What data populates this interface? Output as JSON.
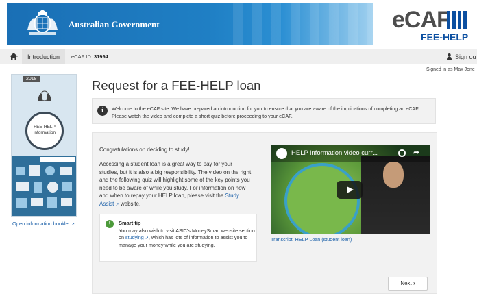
{
  "header": {
    "gov_title": "Australian Government",
    "logo_word": "eCAF",
    "logo_sub": "FEE-HELP"
  },
  "nav": {
    "intro_label": "Introduction",
    "ecaf_id_label": "eCAF ID:",
    "ecaf_id_value": "31994",
    "signout_label": "Sign ou",
    "signed_in": "Signed in as Max Jone"
  },
  "booklet": {
    "year": "2018",
    "clock_text": "FEE-HELP information",
    "link": "Open information booklet"
  },
  "main": {
    "title": "Request for a FEE-HELP loan",
    "alert": "Welcome to the eCAF site. We have prepared an introduction for you to ensure that you are aware of the implications of completing an eCAF. Please watch the video and complete a short quiz before proceeding to your eCAF.",
    "congrats": "Congratulations on deciding to study!",
    "para_text": "Accessing a student loan is a great way to pay for your studies, but it is also a big responsibility. The video on the right and the following quiz will highlight some of the key points you need to be aware of while you study. For information on how and when to repay your HELP loan, please visit the",
    "study_assist": "Study Assist",
    "para_end": "website.",
    "tip_title": "Smart tip",
    "tip_text_1": "You may also wish to visit ASIC's MoneySmart website section on",
    "tip_link": "studying",
    "tip_text_2": ", which has lots of information to assist you to manage your money while you are studying.",
    "video_title": "HELP information video curr...",
    "transcript": "Transcript: HELP Loan (student loan)",
    "next_label": "Next"
  },
  "colors": {
    "brand_blue": "#0b4fa1",
    "link_blue": "#1a5fa8",
    "tip_green": "#4c9a3a"
  }
}
